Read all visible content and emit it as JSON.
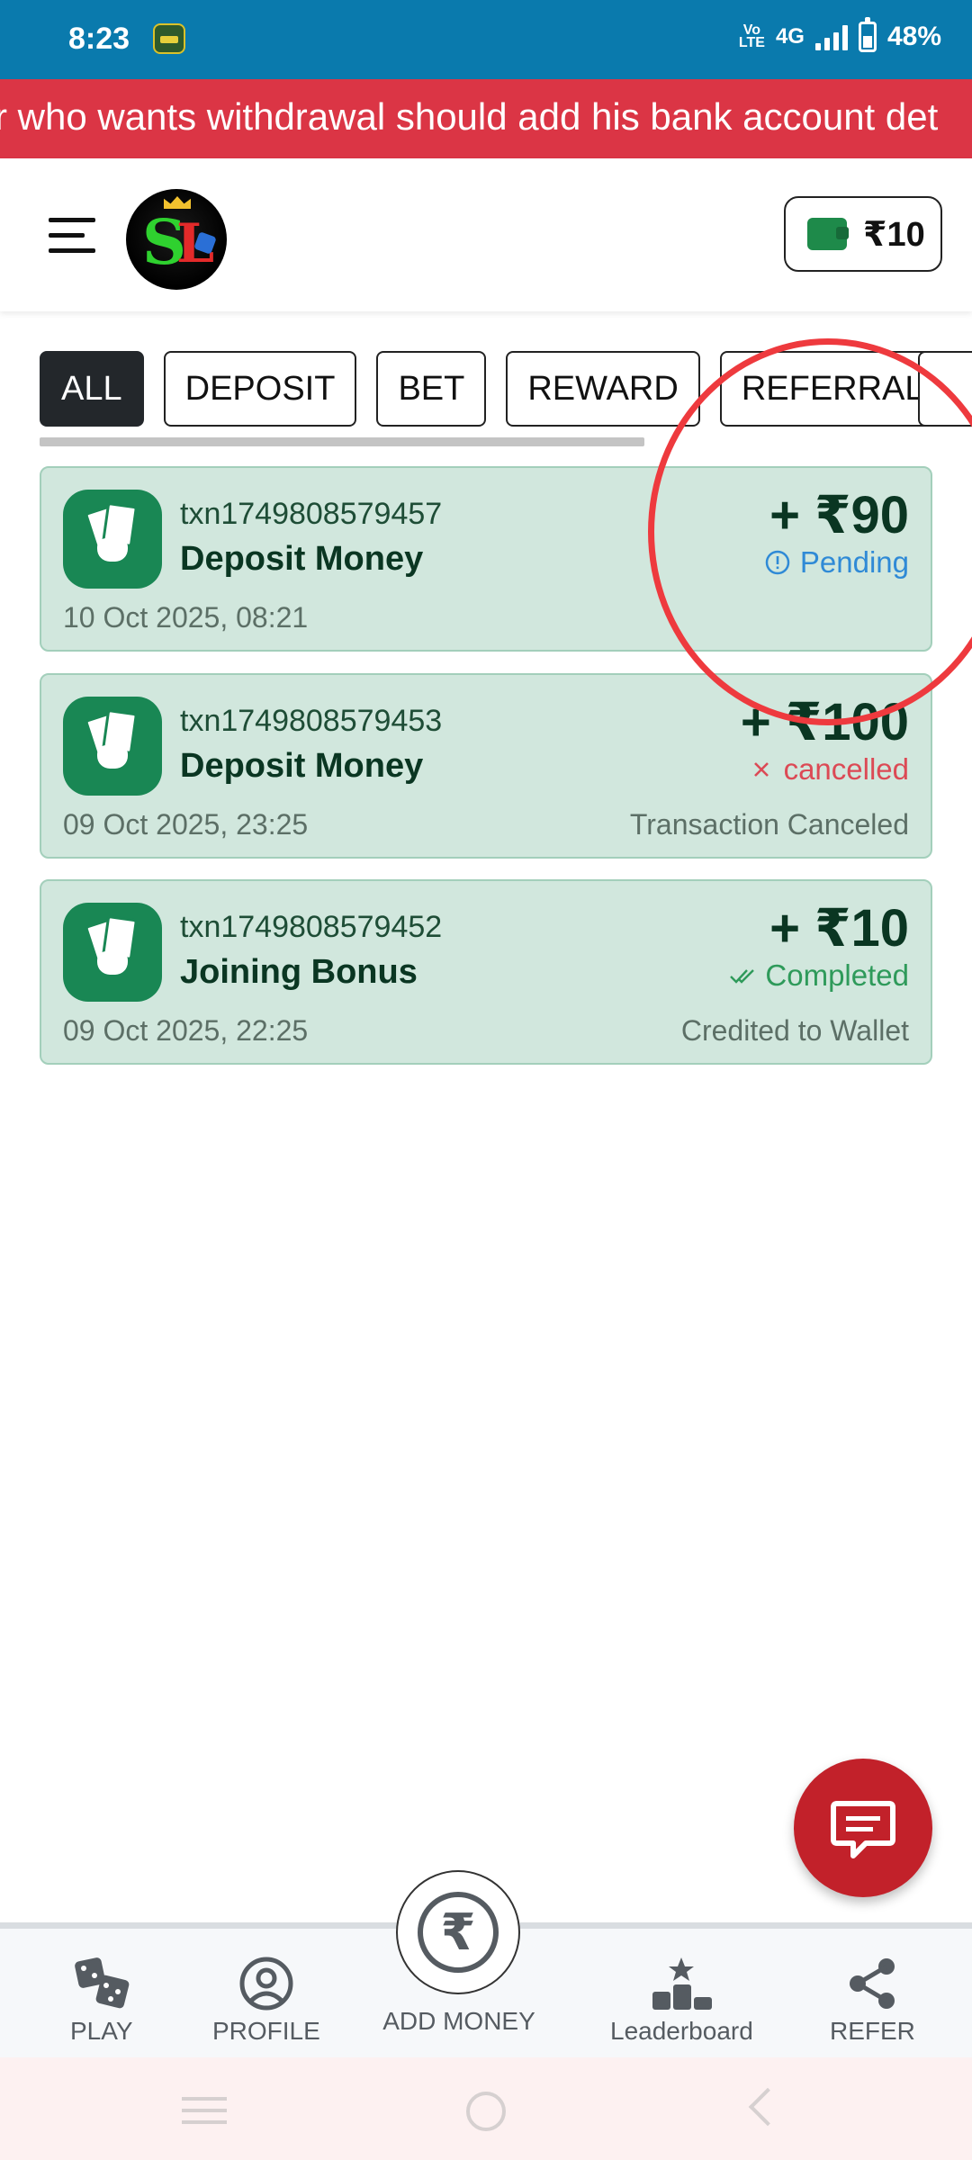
{
  "status_bar": {
    "time": "8:23",
    "volte": "Vo\nLTE",
    "network": "4G",
    "battery": "48%"
  },
  "ticker": {
    "text": "r who wants withdrawal should add his bank account det"
  },
  "header": {
    "menu_icon": "hamburger-icon",
    "logo": "SL-logo",
    "wallet_icon": "wallet-icon",
    "wallet_balance": "₹10"
  },
  "tabs": [
    {
      "label": "ALL",
      "active": true
    },
    {
      "label": "DEPOSIT",
      "active": false
    },
    {
      "label": "BET",
      "active": false
    },
    {
      "label": "REWARD",
      "active": false
    },
    {
      "label": "REFERRAL",
      "active": false
    }
  ],
  "transactions": [
    {
      "id": "txn1749808579457",
      "title": "Deposit Money",
      "date": "10 Oct 2025, 08:21",
      "amount": "+ ₹90",
      "status": "Pending",
      "status_icon": "info-circle-icon",
      "note": ""
    },
    {
      "id": "txn1749808579453",
      "title": "Deposit Money",
      "date": "09 Oct 2025, 23:25",
      "amount": "+ ₹100",
      "status": "cancelled",
      "status_icon": "close-icon",
      "note": "Transaction Canceled"
    },
    {
      "id": "txn1749808579452",
      "title": "Joining Bonus",
      "date": "09 Oct 2025, 22:25",
      "amount": "+ ₹10",
      "status": "Completed",
      "status_icon": "double-check-icon",
      "note": "Credited to Wallet"
    }
  ],
  "bottom_nav": {
    "play": "PLAY",
    "profile": "PROFILE",
    "add_money": "ADD MONEY",
    "add_money_symbol": "₹",
    "leaderboard": "Leaderboard",
    "refer": "REFER"
  },
  "colors": {
    "status_bar": "#0a7aad",
    "ticker": "#db3545",
    "card_bg": "#d1e7dd",
    "icon_green": "#198754",
    "pending": "#2f8ad6",
    "cancelled": "#dc4a55",
    "completed": "#2e9a5a",
    "chat_fab": "#c2212a",
    "annotation": "#ee3a3e"
  }
}
